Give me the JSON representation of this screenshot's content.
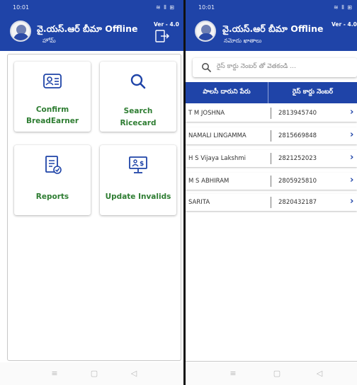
{
  "status_bar": {
    "time": "10:01",
    "icons": "≋ ⦀ ⊞"
  },
  "home_screen": {
    "app_title": "వై.యస్.ఆర్ బీమా Offline",
    "subtitle": "హోమ్",
    "version": "Ver - 4.0",
    "tiles": [
      {
        "line1": "Confirm",
        "line2": "BreadEarner",
        "icon": "id-card-icon"
      },
      {
        "line1": "Search",
        "line2": "Ricecard",
        "icon": "search-icon"
      },
      {
        "line1": "Reports",
        "line2": "",
        "icon": "report-check-icon"
      },
      {
        "line1": "Update Invalids",
        "line2": "",
        "icon": "monitor-dollar-icon"
      }
    ]
  },
  "list_screen": {
    "app_title": "వై.యస్.ఆర్ బీమా Offline",
    "subtitle": "నమోదు ఖాతాలు",
    "version": "Ver - 4.0",
    "search_placeholder": "రైస్ కార్డు నెంబర్ తో వెతకండి ...",
    "col_name": "పాలసీ దారుని పేరు",
    "col_number": "రైస్ కార్డు నెంబర్",
    "rows": [
      {
        "name": "T M JOSHNA",
        "number": "2813945740"
      },
      {
        "name": "NAMALI LINGAMMA",
        "number": "2815669848"
      },
      {
        "name": "H S Vijaya Lakshmi",
        "number": "2821252023"
      },
      {
        "name": "M S ABHIRAM",
        "number": "2805925810"
      },
      {
        "name": "SARITA",
        "number": "2820432187"
      }
    ]
  },
  "colors": {
    "primary": "#1f44a8",
    "tile_label": "#2e7d32",
    "chevron": "#1f44a8"
  }
}
